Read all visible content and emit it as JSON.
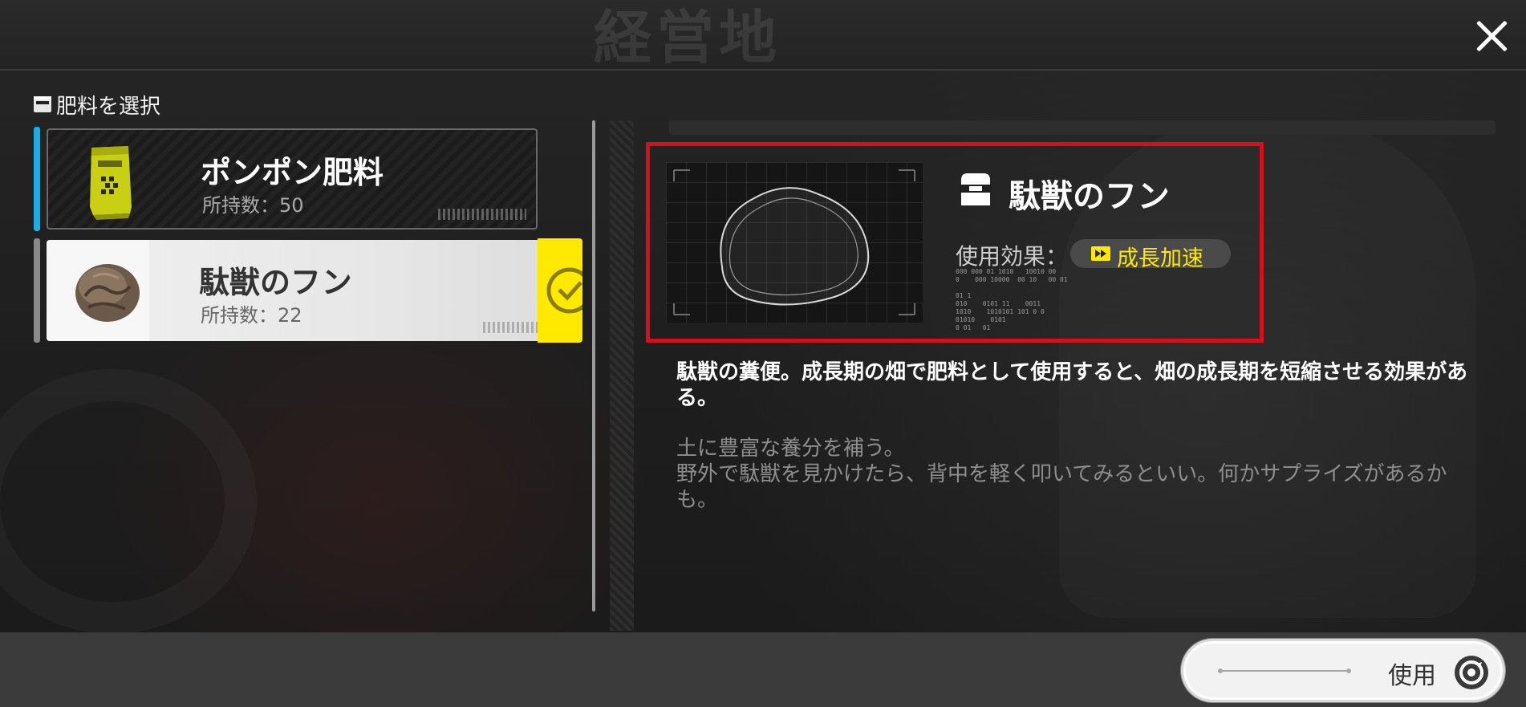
{
  "header": {
    "title": "経営地"
  },
  "left_panel": {
    "section_title": "肥料を選択",
    "items": [
      {
        "name": "ポンポン肥料",
        "count_label": "所持数：50",
        "selected": false
      },
      {
        "name": "駄獣のフン",
        "count_label": "所持数：22",
        "selected": true
      }
    ]
  },
  "detail": {
    "name": "駄獣のフン",
    "effect_label": "使用効果：",
    "effect_value": "成長加速",
    "description": "駄獣の糞便。成長期の畑で肥料として使用すると、畑の成長期を短縮させる効果がある。",
    "flavor": "土に豊富な養分を補う。\n野外で駄獣を見かけたら、背中を軽く叩いてみるといい。何かサプライズがあるかも。",
    "data_text": "000 000 01 1010   10010 00\n0    000 10000  00 10   00 01\n\n01 1\n010    0101 11    0011\n1010    1010101 101 0 0\n01010    0101\n0 01   01"
  },
  "footer": {
    "use_button_label": "使用"
  },
  "colors": {
    "accent_blue": "#19aee8",
    "accent_yellow": "#ffe900",
    "highlight_red": "#d5101c"
  },
  "icons": {
    "close": "close-icon",
    "box": "box-icon",
    "fast_forward": "fast-forward-icon",
    "checkmark": "checkmark-icon",
    "refresh": "refresh-icon"
  }
}
